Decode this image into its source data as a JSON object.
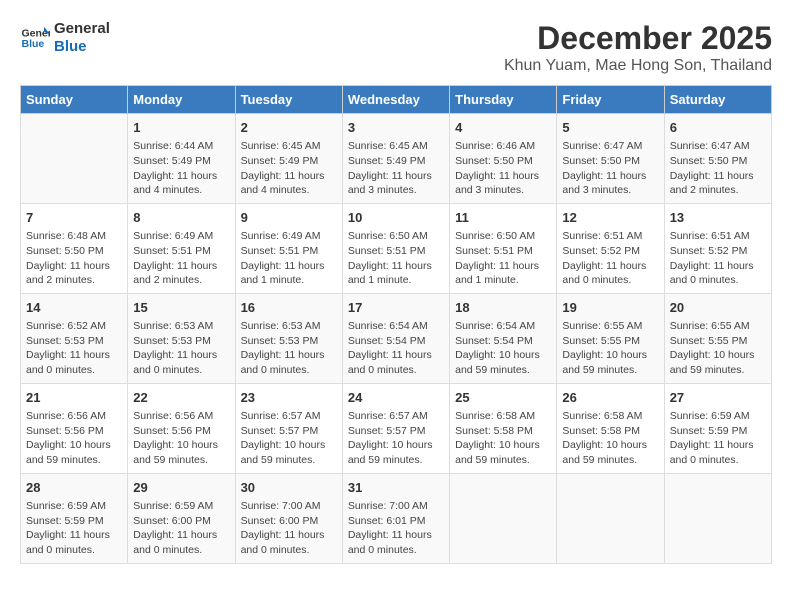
{
  "header": {
    "logo_line1": "General",
    "logo_line2": "Blue",
    "title": "December 2025",
    "subtitle": "Khun Yuam, Mae Hong Son, Thailand"
  },
  "columns": [
    "Sunday",
    "Monday",
    "Tuesday",
    "Wednesday",
    "Thursday",
    "Friday",
    "Saturday"
  ],
  "weeks": [
    [
      {
        "day": "",
        "info": ""
      },
      {
        "day": "1",
        "info": "Sunrise: 6:44 AM\nSunset: 5:49 PM\nDaylight: 11 hours\nand 4 minutes."
      },
      {
        "day": "2",
        "info": "Sunrise: 6:45 AM\nSunset: 5:49 PM\nDaylight: 11 hours\nand 4 minutes."
      },
      {
        "day": "3",
        "info": "Sunrise: 6:45 AM\nSunset: 5:49 PM\nDaylight: 11 hours\nand 3 minutes."
      },
      {
        "day": "4",
        "info": "Sunrise: 6:46 AM\nSunset: 5:50 PM\nDaylight: 11 hours\nand 3 minutes."
      },
      {
        "day": "5",
        "info": "Sunrise: 6:47 AM\nSunset: 5:50 PM\nDaylight: 11 hours\nand 3 minutes."
      },
      {
        "day": "6",
        "info": "Sunrise: 6:47 AM\nSunset: 5:50 PM\nDaylight: 11 hours\nand 2 minutes."
      }
    ],
    [
      {
        "day": "7",
        "info": "Sunrise: 6:48 AM\nSunset: 5:50 PM\nDaylight: 11 hours\nand 2 minutes."
      },
      {
        "day": "8",
        "info": "Sunrise: 6:49 AM\nSunset: 5:51 PM\nDaylight: 11 hours\nand 2 minutes."
      },
      {
        "day": "9",
        "info": "Sunrise: 6:49 AM\nSunset: 5:51 PM\nDaylight: 11 hours\nand 1 minute."
      },
      {
        "day": "10",
        "info": "Sunrise: 6:50 AM\nSunset: 5:51 PM\nDaylight: 11 hours\nand 1 minute."
      },
      {
        "day": "11",
        "info": "Sunrise: 6:50 AM\nSunset: 5:51 PM\nDaylight: 11 hours\nand 1 minute."
      },
      {
        "day": "12",
        "info": "Sunrise: 6:51 AM\nSunset: 5:52 PM\nDaylight: 11 hours\nand 0 minutes."
      },
      {
        "day": "13",
        "info": "Sunrise: 6:51 AM\nSunset: 5:52 PM\nDaylight: 11 hours\nand 0 minutes."
      }
    ],
    [
      {
        "day": "14",
        "info": "Sunrise: 6:52 AM\nSunset: 5:53 PM\nDaylight: 11 hours\nand 0 minutes."
      },
      {
        "day": "15",
        "info": "Sunrise: 6:53 AM\nSunset: 5:53 PM\nDaylight: 11 hours\nand 0 minutes."
      },
      {
        "day": "16",
        "info": "Sunrise: 6:53 AM\nSunset: 5:53 PM\nDaylight: 11 hours\nand 0 minutes."
      },
      {
        "day": "17",
        "info": "Sunrise: 6:54 AM\nSunset: 5:54 PM\nDaylight: 11 hours\nand 0 minutes."
      },
      {
        "day": "18",
        "info": "Sunrise: 6:54 AM\nSunset: 5:54 PM\nDaylight: 10 hours\nand 59 minutes."
      },
      {
        "day": "19",
        "info": "Sunrise: 6:55 AM\nSunset: 5:55 PM\nDaylight: 10 hours\nand 59 minutes."
      },
      {
        "day": "20",
        "info": "Sunrise: 6:55 AM\nSunset: 5:55 PM\nDaylight: 10 hours\nand 59 minutes."
      }
    ],
    [
      {
        "day": "21",
        "info": "Sunrise: 6:56 AM\nSunset: 5:56 PM\nDaylight: 10 hours\nand 59 minutes."
      },
      {
        "day": "22",
        "info": "Sunrise: 6:56 AM\nSunset: 5:56 PM\nDaylight: 10 hours\nand 59 minutes."
      },
      {
        "day": "23",
        "info": "Sunrise: 6:57 AM\nSunset: 5:57 PM\nDaylight: 10 hours\nand 59 minutes."
      },
      {
        "day": "24",
        "info": "Sunrise: 6:57 AM\nSunset: 5:57 PM\nDaylight: 10 hours\nand 59 minutes."
      },
      {
        "day": "25",
        "info": "Sunrise: 6:58 AM\nSunset: 5:58 PM\nDaylight: 10 hours\nand 59 minutes."
      },
      {
        "day": "26",
        "info": "Sunrise: 6:58 AM\nSunset: 5:58 PM\nDaylight: 10 hours\nand 59 minutes."
      },
      {
        "day": "27",
        "info": "Sunrise: 6:59 AM\nSunset: 5:59 PM\nDaylight: 11 hours\nand 0 minutes."
      }
    ],
    [
      {
        "day": "28",
        "info": "Sunrise: 6:59 AM\nSunset: 5:59 PM\nDaylight: 11 hours\nand 0 minutes."
      },
      {
        "day": "29",
        "info": "Sunrise: 6:59 AM\nSunset: 6:00 PM\nDaylight: 11 hours\nand 0 minutes."
      },
      {
        "day": "30",
        "info": "Sunrise: 7:00 AM\nSunset: 6:00 PM\nDaylight: 11 hours\nand 0 minutes."
      },
      {
        "day": "31",
        "info": "Sunrise: 7:00 AM\nSunset: 6:01 PM\nDaylight: 11 hours\nand 0 minutes."
      },
      {
        "day": "",
        "info": ""
      },
      {
        "day": "",
        "info": ""
      },
      {
        "day": "",
        "info": ""
      }
    ]
  ]
}
